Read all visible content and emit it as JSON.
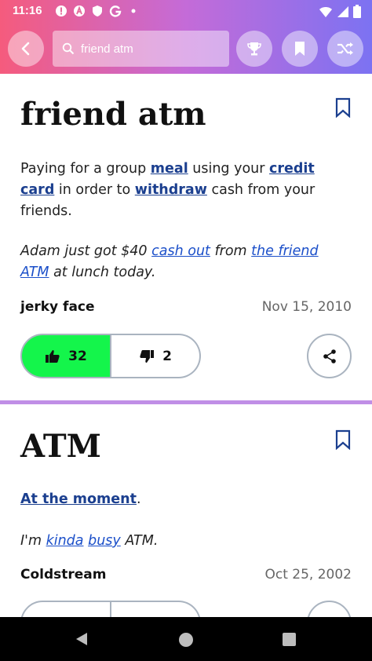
{
  "status_bar": {
    "time": "11:16",
    "left_icons": [
      "warning-icon",
      "a-icon",
      "shield-icon",
      "g-icon",
      "dot-icon"
    ],
    "right_icons": [
      "wifi-icon",
      "signal-icon",
      "battery-icon"
    ]
  },
  "header": {
    "search_query": "friend atm",
    "buttons": [
      "back-icon",
      "trophy-icon",
      "bookmark-icon",
      "shuffle-icon"
    ]
  },
  "entries": [
    {
      "word": "friend atm",
      "meaning": [
        {
          "t": "Paying for a group "
        },
        {
          "t": "meal",
          "link": true
        },
        {
          "t": " using your "
        },
        {
          "t": "credit card",
          "link": true
        },
        {
          "t": " in order to "
        },
        {
          "t": "withdraw",
          "link": true
        },
        {
          "t": " cash from your friends."
        }
      ],
      "example": [
        {
          "t": "Adam just got $40 "
        },
        {
          "t": "cash out",
          "link": true
        },
        {
          "t": " from "
        },
        {
          "t": "the friend ATM",
          "link": true
        },
        {
          "t": " at lunch today."
        }
      ],
      "author": "jerky face",
      "date": "Nov 15, 2010",
      "upvotes": "32",
      "downvotes": "2"
    },
    {
      "word": "ATM",
      "meaning": [
        {
          "t": "At the moment",
          "link": true
        },
        {
          "t": "."
        }
      ],
      "example": [
        {
          "t": "I'm "
        },
        {
          "t": "kinda",
          "link": true
        },
        {
          "t": " "
        },
        {
          "t": "busy",
          "link": true
        },
        {
          "t": " ATM."
        }
      ],
      "author": "Coldstream",
      "date": "Oct 25, 2002"
    }
  ],
  "colors": {
    "upvote_active": "#14f54b",
    "link": "#1b3f8f",
    "divider": "#c08ee6"
  }
}
